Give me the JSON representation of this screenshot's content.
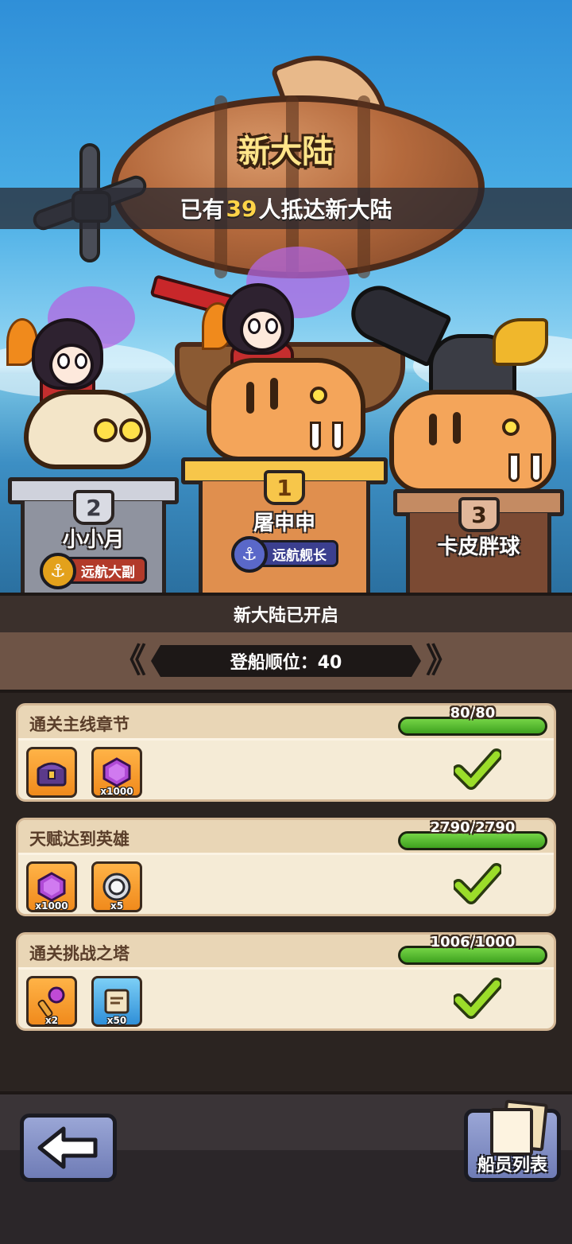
{
  "header": {
    "title": "新大陆",
    "banner_prefix": "已有",
    "banner_count": "39",
    "banner_suffix": "人抵达新大陆"
  },
  "podium": [
    {
      "rank": "2",
      "name": "小小月",
      "title_tag": "远航大副",
      "tag_color": "#b23a2a",
      "icon": "anchor-icon"
    },
    {
      "rank": "1",
      "name": "屠申申",
      "title_tag": "远航舰长",
      "tag_color": "#3b3f8f",
      "icon": "anchor-icon"
    },
    {
      "rank": "3",
      "name": "卡皮胖球",
      "title_tag": "",
      "icon": ""
    }
  ],
  "status": {
    "opened_text": "新大陆已开启",
    "boarding_label": "登船顺位：40"
  },
  "tasks": [
    {
      "title": "通关主线章节",
      "progress_text": "80/80",
      "progress": 1.0,
      "completed": true,
      "rewards": [
        {
          "icon": "treasure-chest-icon",
          "qty": "",
          "style": "orange"
        },
        {
          "icon": "purple-gem-icon",
          "qty": "x1000",
          "style": "orange"
        }
      ]
    },
    {
      "title": "天赋达到英雄",
      "progress_text": "2790/2790",
      "progress": 1.0,
      "completed": true,
      "rewards": [
        {
          "icon": "purple-gem-icon",
          "qty": "x1000",
          "style": "orange"
        },
        {
          "icon": "silver-coin-icon",
          "qty": "x5",
          "style": "orange"
        }
      ]
    },
    {
      "title": "通关挑战之塔",
      "progress_text": "1006/1000",
      "progress": 1.0,
      "completed": true,
      "rewards": [
        {
          "icon": "magic-scepter-icon",
          "qty": "x2",
          "style": "orange"
        },
        {
          "icon": "scroll-icon",
          "qty": "x50",
          "style": "blue"
        }
      ]
    }
  ],
  "footer": {
    "back_icon": "back-arrow-icon",
    "crew_list_label": "船员列表",
    "crew_icon": "document-list-icon"
  }
}
